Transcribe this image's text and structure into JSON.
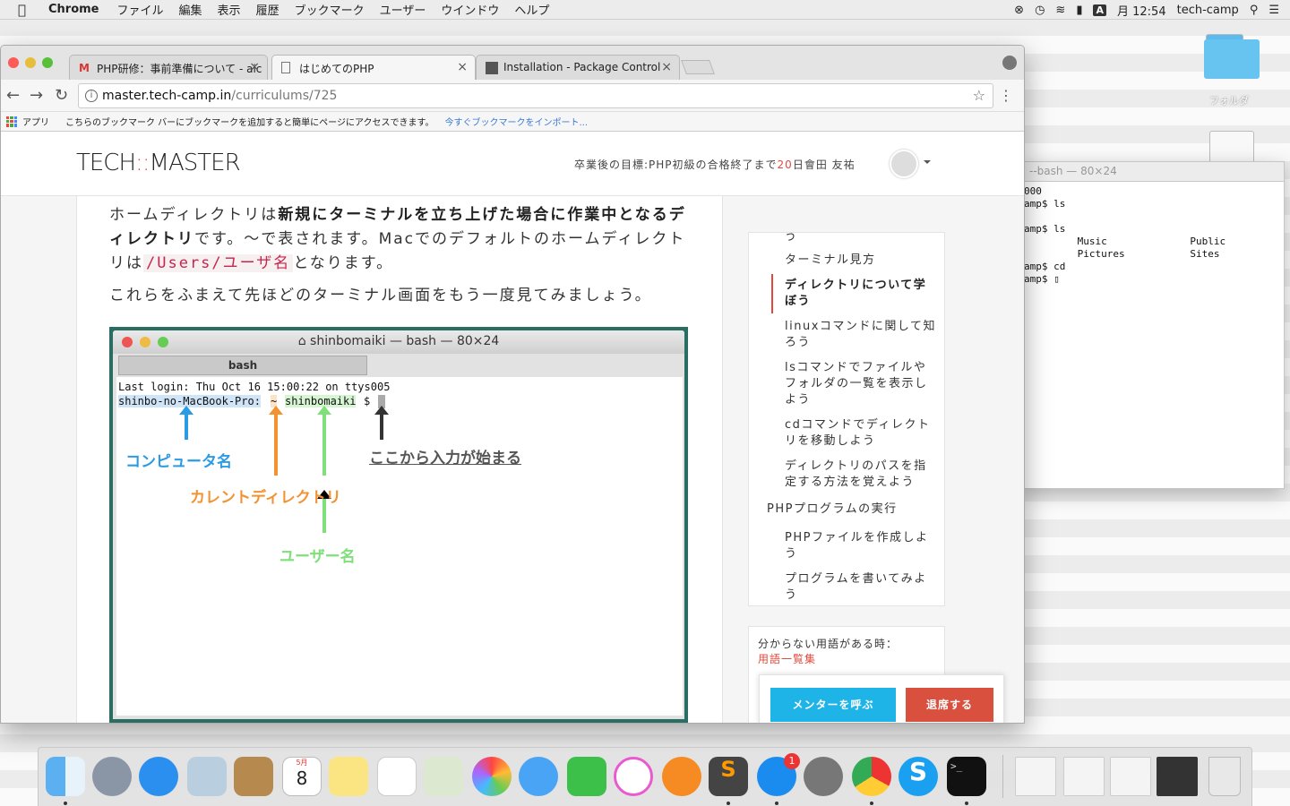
{
  "menubar": {
    "app": "Chrome",
    "items": [
      "ファイル",
      "編集",
      "表示",
      "履歴",
      "ブックマーク",
      "ユーザー",
      "ウインドウ",
      "ヘルプ"
    ],
    "clock": "月 12:54",
    "user": "tech-camp",
    "input_mode": "A"
  },
  "desktop": {
    "folder_label": "フォルダ"
  },
  "terminal_window": {
    "title": "--bash — 80×24",
    "lines": [
      "000",
      "amp$ ls",
      "",
      "amp$ ls",
      "         Music              Public",
      "         Pictures           Sites",
      "amp$ cd",
      "amp$ ▯"
    ]
  },
  "chrome": {
    "tabs": [
      {
        "label": "PHP研修：事前準備について - aic",
        "favicon": "gmail-icon"
      },
      {
        "label": "はじめてのPHP",
        "favicon": "page-icon"
      },
      {
        "label": "Installation - Package Control",
        "favicon": "package-icon"
      }
    ],
    "url_host": "master.tech-camp.in",
    "url_path": "/curriculums/725",
    "bookmarks_apps": "アプリ",
    "bookmarks_hint": "こちらのブックマーク バーにブックマークを追加すると簡単にページにアクセスできます。",
    "bookmarks_import": "今すぐブックマークをインポート..."
  },
  "site": {
    "logo_a": "TECH",
    "logo_sep": "::",
    "logo_b": "MASTER",
    "goal_prefix": "卒業後の目標:PHP初級の合格終了まで",
    "goal_days": "20",
    "goal_suffix": "日會田 友祐"
  },
  "article": {
    "p1_a": "ホームディレクトリは",
    "p1_b": "新規にターミナルを立ち上げた場合に作業中となるディレクトリ",
    "p1_c": "です。〜で表されます。Macでのデフォルトのホームディレクトリは",
    "p1_code": "/Users/ユーザ名",
    "p1_d": "となります。",
    "p2": "これらをふまえて先ほどのターミナル画面をもう一度見てみましょう。",
    "shot": {
      "title": "shinbomaiki — bash — 80×24",
      "tab": "bash",
      "line1": "Last login: Thu Oct 16 15:00:22 on ttys005",
      "host": "shinbo-no-MacBook-Pro:",
      "tilde": "~",
      "user": "shinbomaiki",
      "prompt": "$",
      "ann_computer": "コンピュータ名",
      "ann_current": "カレントディレクトリ",
      "ann_user": "ユーザー名",
      "ann_input": "ここから入力が始まる"
    }
  },
  "toc": {
    "items": [
      {
        "label": "う"
      },
      {
        "label": "ターミナル見方"
      },
      {
        "label": "ディレクトリについて学ぼう",
        "active": true
      },
      {
        "label": "linuxコマンドに関して知ろう"
      },
      {
        "label": "lsコマンドでファイルやフォルダの一覧を表示しよう"
      },
      {
        "label": "cdコマンドでディレクトリを移動しよう"
      },
      {
        "label": "ディレクトリのパスを指定する方法を覚えよう"
      },
      {
        "label": "PHPプログラムの実行"
      },
      {
        "label": "PHPファイルを作成しよう"
      },
      {
        "label": "プログラムを書いてみよう"
      }
    ]
  },
  "help": {
    "text": "分からない用語がある時：",
    "link": "用語一覧集"
  },
  "actions": {
    "call_mentor": "メンターを呼ぶ",
    "leave": "退席する"
  },
  "dock": {
    "calendar_month": "5月",
    "calendar_day": "8",
    "appstore_badge": "1",
    "terminal_glyph": ">_"
  },
  "colors": {
    "accent": "#e2483b",
    "mentor": "#1fb4e8",
    "leave": "#d9503f",
    "computer": "#2a9be5",
    "current": "#f39230",
    "user": "#7fe07a"
  }
}
